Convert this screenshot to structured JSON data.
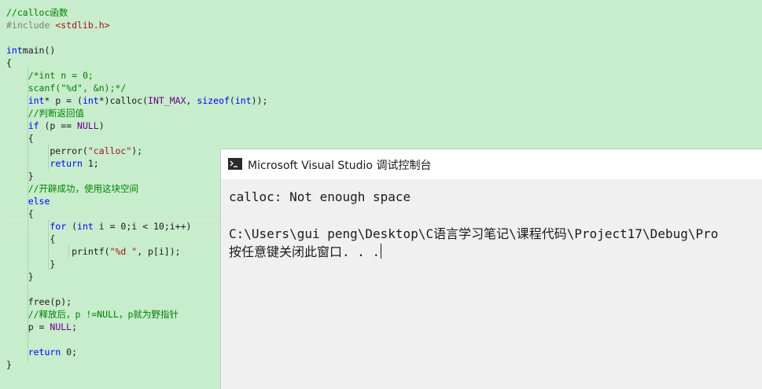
{
  "editor": {
    "lines": [
      [
        [
          "cm",
          "//calloc函数"
        ]
      ],
      [
        [
          "pp",
          "#include "
        ],
        [
          "st",
          "<stdlib.h>"
        ]
      ],
      [],
      [
        [
          "kw",
          "int"
        ],
        [
          "",
          "main()"
        ]
      ],
      [
        [
          "",
          "{"
        ]
      ],
      [
        [
          "",
          "    "
        ],
        [
          "cm",
          "/*int n = 0;"
        ]
      ],
      [
        [
          "",
          "    "
        ],
        [
          "cm",
          "scanf(\"%d\", &n);*/"
        ]
      ],
      [
        [
          "",
          "    "
        ],
        [
          "kw",
          "int"
        ],
        [
          "",
          "* p = ("
        ],
        [
          "kw",
          "int"
        ],
        [
          "",
          "*)calloc("
        ],
        [
          "mc",
          "INT_MAX"
        ],
        [
          "",
          ", "
        ],
        [
          "kw",
          "sizeof"
        ],
        [
          "",
          "("
        ],
        [
          "kw",
          "int"
        ],
        [
          "",
          "));"
        ]
      ],
      [
        [
          "",
          "    "
        ],
        [
          "cm",
          "//判断返回值"
        ]
      ],
      [
        [
          "",
          "    "
        ],
        [
          "kw",
          "if"
        ],
        [
          "",
          " (p == "
        ],
        [
          "mc",
          "NULL"
        ],
        [
          "",
          ")"
        ]
      ],
      [
        [
          "",
          "    {"
        ]
      ],
      [
        [
          "",
          "        perror("
        ],
        [
          "st",
          "\"calloc\""
        ],
        [
          "",
          ");"
        ]
      ],
      [
        [
          "",
          "        "
        ],
        [
          "kw",
          "return"
        ],
        [
          "",
          "",
          " 1;"
        ]
      ],
      [
        [
          "",
          "    }"
        ]
      ],
      [
        [
          "",
          "    "
        ],
        [
          "cm",
          "//开辟成功，使用这块空间"
        ]
      ],
      [
        [
          "",
          "    "
        ],
        [
          "kw",
          "else"
        ]
      ],
      [
        [
          "",
          "    {"
        ]
      ],
      [
        [
          "",
          "        "
        ],
        [
          "kw",
          "for"
        ],
        [
          "",
          "",
          " ("
        ],
        [
          "kw",
          "int"
        ],
        [
          "",
          "",
          " i = 0;i < 10;i++)"
        ]
      ],
      [
        [
          "",
          "        {"
        ]
      ],
      [
        [
          "",
          "            printf("
        ],
        [
          "st",
          "\"%d \""
        ],
        [
          "",
          ", p[i]);"
        ]
      ],
      [
        [
          "",
          "        }"
        ]
      ],
      [
        [
          "",
          "    }"
        ]
      ],
      [],
      [
        [
          "",
          "    free(p);"
        ]
      ],
      [
        [
          "",
          "    "
        ],
        [
          "cm",
          "//释放后，p !=NULL，p就为野指针"
        ]
      ],
      [
        [
          "",
          "    p = "
        ],
        [
          "mc",
          "NULL"
        ],
        [
          "",
          ";"
        ]
      ],
      [],
      [
        [
          "",
          "    "
        ],
        [
          "kw",
          "return"
        ],
        [
          "",
          "",
          " 0;"
        ]
      ],
      [
        [
          "",
          "}"
        ]
      ]
    ]
  },
  "console": {
    "title": "Microsoft Visual Studio 调试控制台",
    "icon": "terminal-icon",
    "line1": "calloc: Not enough space",
    "line2": "C:\\Users\\gui peng\\Desktop\\C语言学习笔记\\课程代码\\Project17\\Debug\\Pro",
    "line3": "按任意键关闭此窗口. . ."
  }
}
